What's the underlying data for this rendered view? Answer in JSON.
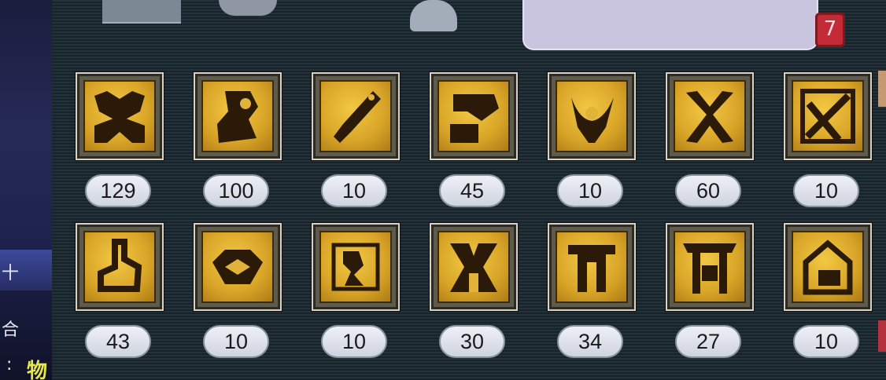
{
  "side_panel": {
    "char_a": "十",
    "char_b": "合",
    "char_c": ":",
    "char_d": "物"
  },
  "close_label": "7",
  "inventory": [
    {
      "icon": "rune-crown-icon",
      "count": "129"
    },
    {
      "icon": "rune-spiral-sun-icon",
      "count": "100"
    },
    {
      "icon": "rune-dagger-icon",
      "count": "10"
    },
    {
      "icon": "rune-hammer-icon",
      "count": "45"
    },
    {
      "icon": "rune-crescent-blade-icon",
      "count": "10"
    },
    {
      "icon": "rune-crossed-wings-icon",
      "count": "60"
    },
    {
      "icon": "rune-crossed-tools-icon",
      "count": "10"
    },
    {
      "icon": "rune-knot-icon",
      "count": "43"
    },
    {
      "icon": "rune-chain-icon",
      "count": "10"
    },
    {
      "icon": "rune-runner-icon",
      "count": "10"
    },
    {
      "icon": "rune-gate-icon",
      "count": "30"
    },
    {
      "icon": "rune-temple-icon",
      "count": "34"
    },
    {
      "icon": "rune-torii-icon",
      "count": "27"
    },
    {
      "icon": "rune-helmet-icon",
      "count": "10"
    }
  ]
}
